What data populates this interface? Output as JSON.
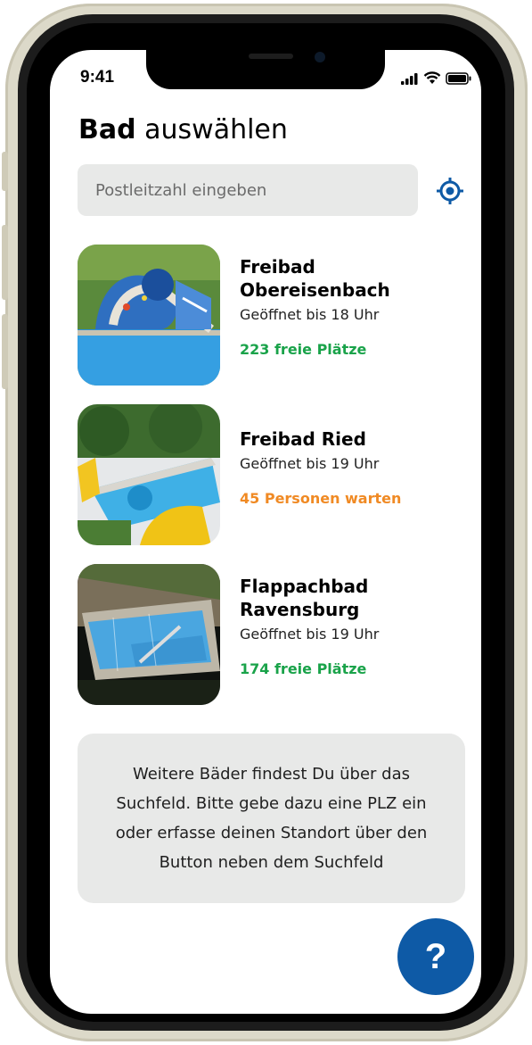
{
  "status_bar": {
    "time": "9:41"
  },
  "header": {
    "title_bold": "Bad",
    "title_rest": " auswählen"
  },
  "search": {
    "placeholder": "Postleitzahl eingeben"
  },
  "colors": {
    "accent": "#0e5aa6",
    "free": "#1aa34a",
    "waiting": "#f08a24"
  },
  "pools": [
    {
      "name": "Freibad Obereisenbach",
      "hours": "Geöffnet bis 18 Uhr",
      "status": "223 freie Plätze",
      "status_kind": "free"
    },
    {
      "name": "Freibad Ried",
      "hours": "Geöffnet bis 19 Uhr",
      "status": "45 Personen warten",
      "status_kind": "waiting"
    },
    {
      "name": "Flappachbad Ravensburg",
      "hours": "Geöffnet bis 19 Uhr",
      "status": "174 freie Plätze",
      "status_kind": "free"
    }
  ],
  "hint": {
    "text": "Weitere Bäder findest Du über das Suchfeld. Bitte gebe dazu eine PLZ ein oder erfasse deinen Standort über den Button neben dem Suchfeld"
  },
  "help_button": {
    "label": "?"
  }
}
